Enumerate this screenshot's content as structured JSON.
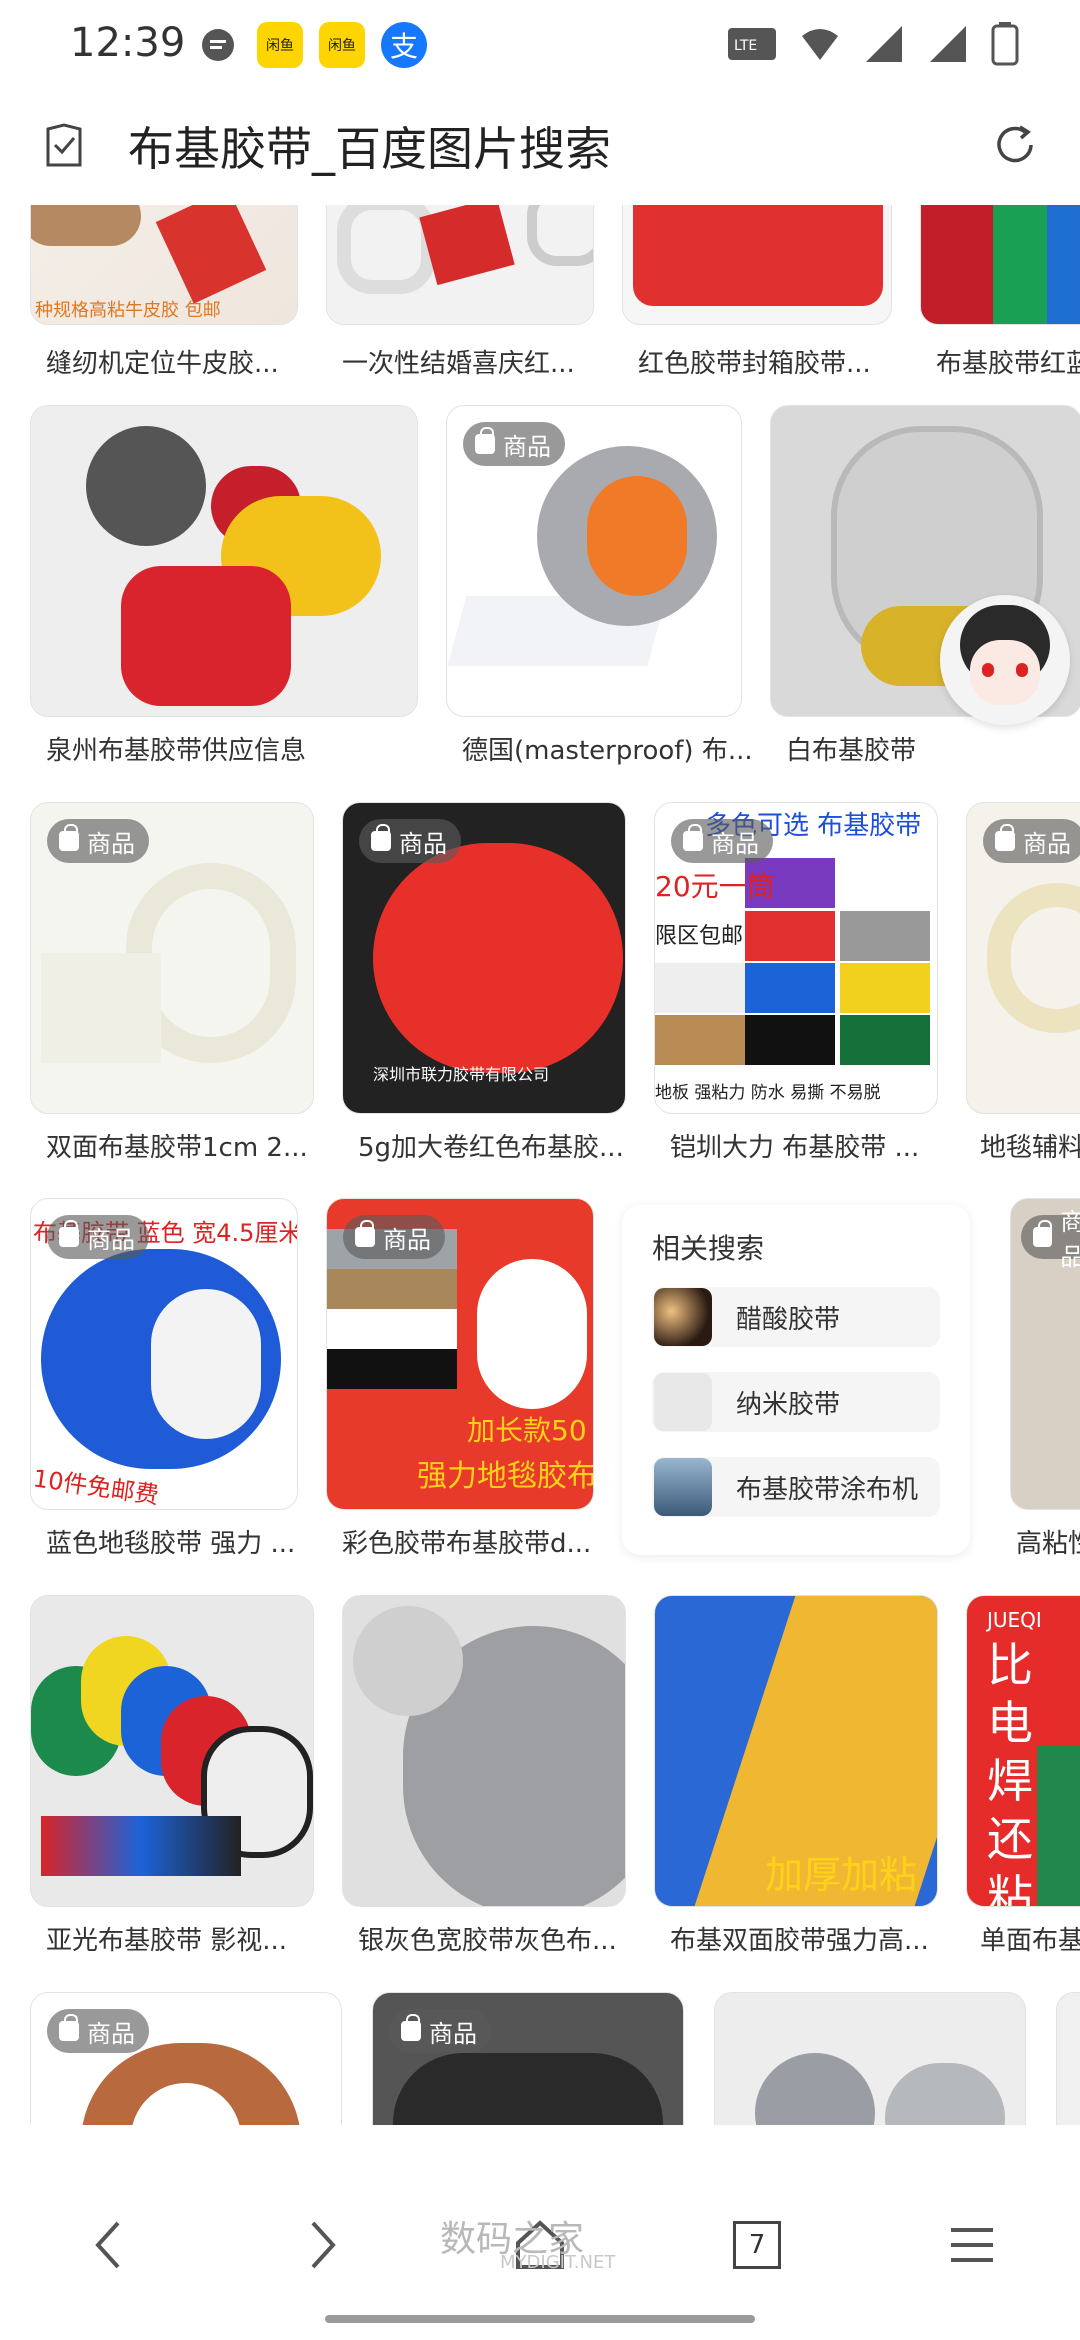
{
  "status": {
    "time": "12:39",
    "app_icon_1": "闲鱼",
    "app_icon_2": "闲鱼",
    "alipay": "支"
  },
  "header": {
    "title": "布基胶带_百度图片搜索"
  },
  "badge_label": "商品",
  "rows": [
    {
      "captions": [
        "缝纫机定位牛皮胶...",
        "一次性结婚喜庆红...",
        "红色胶带封箱胶带...",
        "布基胶带红蓝"
      ],
      "thumb_text_0": "种规格高粘牛皮胶  包邮"
    },
    {
      "captions": [
        "泉州布基胶带供应信息",
        "德国(masterproof) 布...",
        "白布基胶带"
      ]
    },
    {
      "captions": [
        "双面布基胶带1cm 2...",
        "5g加大卷红色布基胶...",
        "铠圳大力 布基胶带 ...",
        "地毯辅料"
      ],
      "thumb_text_1": "深圳市联力胶带有限公司",
      "thumb_text_2_top": "多色可选  布基胶带",
      "thumb_text_2_mid": "20元一筒",
      "thumb_text_2_mid2": "限区包邮",
      "thumb_text_2_bottom": "地板  强粘力  防水  易撕  不易脱"
    },
    {
      "captions": [
        "蓝色地毯胶带 强力 ...",
        "彩色胶带布基胶带d...",
        "高粘性"
      ],
      "thumb_text_0_top": "布基胶带 蓝色 宽4.5厘米",
      "thumb_text_0_bottom": "10件免邮费",
      "thumb_text_1_a": "加长款50",
      "thumb_text_1_b": "强力地毯胶布"
    },
    {
      "captions": [
        "亚光布基胶带 影视...",
        "银灰色宽胶带灰色布...",
        "布基双面胶带强力高...",
        "单面布基"
      ],
      "thumb_text_2": "加厚加粘",
      "thumb_text_3_brand": "JUEQI",
      "thumb_text_3": "比电焊还粘"
    },
    {
      "captions": []
    }
  ],
  "related": {
    "title": "相关搜索",
    "items": [
      {
        "label": "醋酸胶带"
      },
      {
        "label": "纳米胶带"
      },
      {
        "label": "布基胶带涂布机"
      }
    ]
  },
  "bottom_nav": {
    "tab_count": "7"
  },
  "watermark": {
    "main": "数码之家",
    "sub": "MYDIGIT.NET"
  },
  "colors": {
    "accent": "#000000",
    "badge_bg": "#5a5a5a"
  }
}
